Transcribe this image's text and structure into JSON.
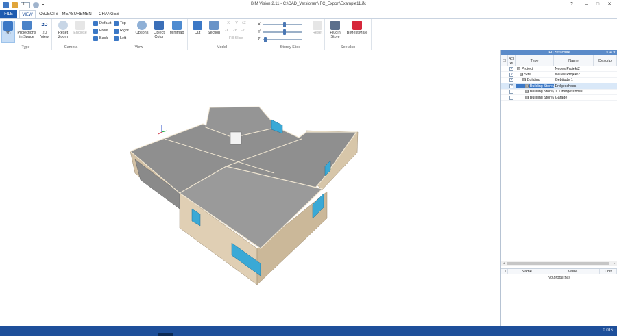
{
  "window": {
    "title": "BIM Vision 2.11 - C:\\CAD_Versionen\\IFC_Export\\Example11.ifc",
    "quick_access_value": "1",
    "minimize": "–",
    "maximize": "□",
    "close": "✕"
  },
  "tabs": [
    {
      "label": "FILE"
    },
    {
      "label": "VIEW"
    },
    {
      "label": "OBJECTS"
    },
    {
      "label": "MEASUREMENT"
    },
    {
      "label": "CHANGES"
    }
  ],
  "ribbon": {
    "type": {
      "label": "Type",
      "btn_3d": "3D",
      "btn_proj": "Projections in Space",
      "btn_2d": "2D View"
    },
    "camera": {
      "label": "Camera",
      "reset_zoom": "Reset Zoom",
      "enclose": "Enclose"
    },
    "views": {
      "default": "Default",
      "top": "Top",
      "front": "Front",
      "right": "Right",
      "back": "Back",
      "left": "Left"
    },
    "view": {
      "label": "View",
      "options": "Options",
      "object_color": "Object Color",
      "minimap": "Minimap"
    },
    "model": {
      "label": "Model",
      "cut": "Cut",
      "section": "Section",
      "px": "+X",
      "py": "+Y",
      "pz": "+Z",
      "mx": "-X",
      "my": "-Y",
      "mz": "-Z",
      "fill_slice": "Fill Slice"
    },
    "storey": {
      "label": "Storey Slide",
      "x": "X",
      "y": "Y",
      "z": "Z",
      "reset": "Reset"
    },
    "see_also": {
      "label": "See also",
      "plugin_store": "Plugin Store",
      "bimestimate": "BIMestiMate"
    }
  },
  "ifc_panel": {
    "title": "IFC Structure",
    "col_active": "Acti ve",
    "col_type": "Type",
    "col_name": "Name",
    "col_desc": "Descrip",
    "rows": [
      {
        "type": "Project",
        "name": "Neues Projekt2",
        "checked": "✓",
        "expander": "⊟"
      },
      {
        "type": "Site",
        "name": "Neues Projekt2",
        "checked": "✓",
        "expander": "⊟"
      },
      {
        "type": "Building",
        "name": "Gebäude 1",
        "checked": "✓",
        "expander": "⊟"
      },
      {
        "type": "Building Storey",
        "name": "Erdgeschoss",
        "checked": "✓",
        "expander": "⊞"
      },
      {
        "type": "Building Storey",
        "name": "1. Obergeschoss",
        "checked": "",
        "expander": "⊞"
      },
      {
        "type": "Building Storey",
        "name": "Garage",
        "checked": "",
        "expander": "⊞"
      }
    ]
  },
  "props_panel": {
    "col_name": "Name",
    "col_value": "Value",
    "col_unit": "Unit",
    "empty": "No properties"
  },
  "status": {
    "fps": "0.01s"
  },
  "colors": {
    "accent": "#1e5bb0",
    "status_bar": "#1e4f9a",
    "panel_title": "#5b8bc9",
    "wall": "#d8c7ad",
    "roof": "#8e8e8e",
    "glass": "#3aa9d6"
  }
}
